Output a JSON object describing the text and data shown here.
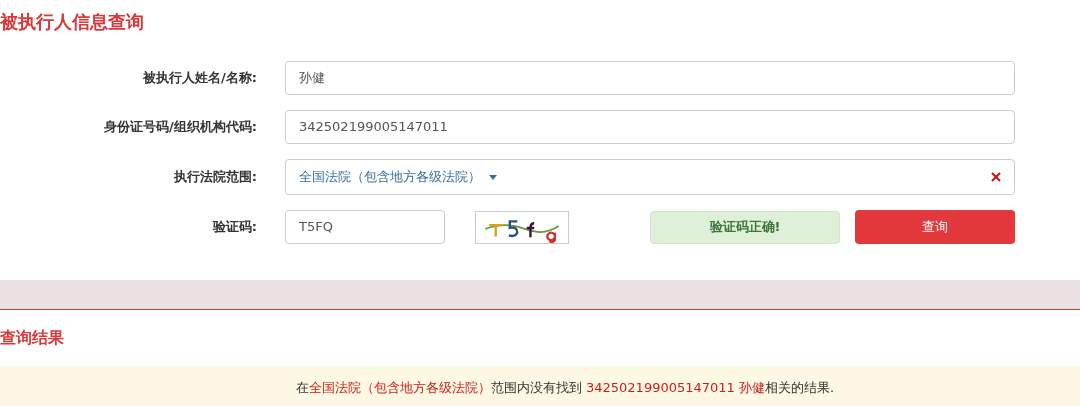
{
  "title": "被执行人信息查询",
  "form": {
    "name": {
      "label": "被执行人姓名/名称:",
      "value": "孙健"
    },
    "id": {
      "label": "身份证号码/组织机构代码:",
      "value": "342502199005147011"
    },
    "court": {
      "label": "执行法院范围:",
      "value": "全国法院（包含地方各级法院）"
    },
    "captcha": {
      "label": "验证码:",
      "value": "T5FQ",
      "status": "验证码正确!"
    },
    "submit": "查询"
  },
  "results": {
    "title": "查询结果",
    "message": [
      {
        "kind": "plain",
        "text": "在"
      },
      {
        "kind": "highlight",
        "text": "全国法院（包含地方各级法院）"
      },
      {
        "kind": "plain",
        "text": "范围内没有找到 "
      },
      {
        "kind": "highlight",
        "text": "342502199005147011 孙健"
      },
      {
        "kind": "plain",
        "text": "相关的结果."
      }
    ]
  }
}
